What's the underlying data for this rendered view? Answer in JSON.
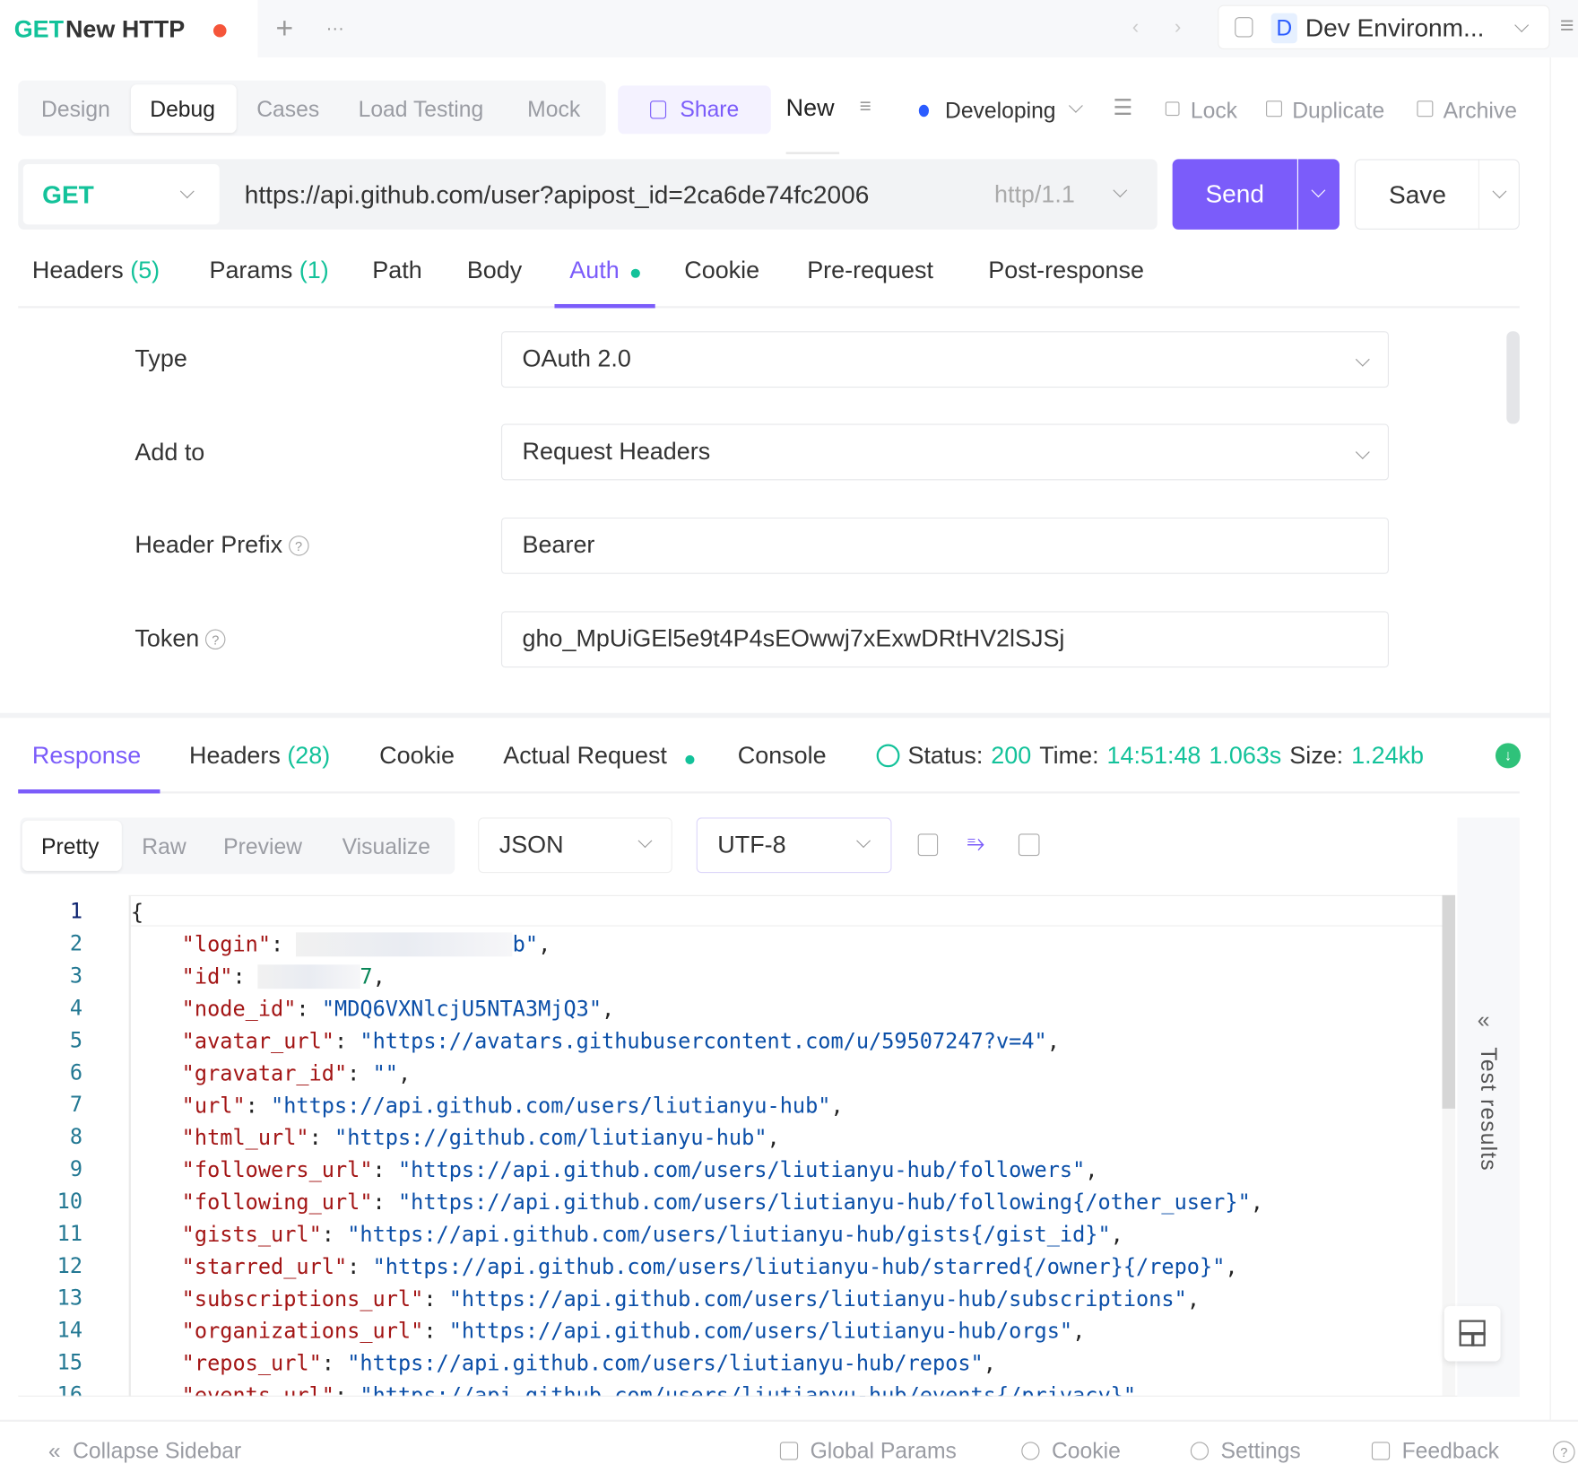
{
  "colors": {
    "accent": "#7b5cfa",
    "green": "#13c29a",
    "unsaved_dot": "#f5553a",
    "developing_dot": "#2b5cff"
  },
  "tabbar": {
    "method": "GET",
    "title": "New HTTP",
    "add": "+",
    "more": "···",
    "env_badge": "D",
    "env": "Dev Environm..."
  },
  "modes": [
    {
      "label": "Design"
    },
    {
      "label": "Debug",
      "active": true
    },
    {
      "label": "Cases"
    },
    {
      "label": "Load Testing"
    },
    {
      "label": "Mock"
    }
  ],
  "toolbar": {
    "share": "Share",
    "new": "New",
    "status": "Developing",
    "lock": "Lock",
    "duplicate": "Duplicate",
    "archive": "Archive"
  },
  "request": {
    "method": "GET",
    "url": "https://api.github.com/user?apipost_id=2ca6de74fc2006",
    "protocol": "http/1.1",
    "send": "Send",
    "save": "Save"
  },
  "req_tabs": {
    "headers": "Headers",
    "headers_count": "(5)",
    "params": "Params",
    "params_count": "(1)",
    "path": "Path",
    "body": "Body",
    "auth": "Auth",
    "cookie": "Cookie",
    "pre": "Pre-request",
    "post": "Post-response"
  },
  "auth": {
    "type_label": "Type",
    "type_value": "OAuth 2.0",
    "addto_label": "Add to",
    "addto_value": "Request Headers",
    "prefix_label": "Header Prefix",
    "prefix_value": "Bearer",
    "token_label": "Token",
    "token_value": "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"
  },
  "resp_tabs": {
    "response": "Response",
    "headers": "Headers",
    "headers_count": "(28)",
    "cookie": "Cookie",
    "actual": "Actual Request",
    "console": "Console"
  },
  "resp_status": {
    "status_label": "Status:",
    "status": "200",
    "time_label": "Time:",
    "time": "14:51:48",
    "duration": "1.063s",
    "size_label": "Size:",
    "size": "1.24kb"
  },
  "view_modes": [
    {
      "label": "Pretty",
      "active": true
    },
    {
      "label": "Raw"
    },
    {
      "label": "Preview"
    },
    {
      "label": "Visualize"
    }
  ],
  "format": "JSON",
  "encoding": "UTF-8",
  "test_results": "Test results",
  "code_lines": [
    [
      [
        "p",
        "{"
      ]
    ],
    [
      [
        "k",
        "    \"login\""
      ],
      [
        "p",
        ": "
      ],
      [
        "redact",
        "                 "
      ],
      [
        "s",
        "b\""
      ],
      [
        "p",
        ","
      ]
    ],
    [
      [
        "k",
        "    \"id\""
      ],
      [
        "p",
        ": "
      ],
      [
        "redact",
        "        "
      ],
      [
        "n",
        "7"
      ],
      [
        "p",
        ","
      ]
    ],
    [
      [
        "k",
        "    \"node_id\""
      ],
      [
        "p",
        ": "
      ],
      [
        "s",
        "\"MDQ6VXNlcjU5NTA3MjQ3\""
      ],
      [
        "p",
        ","
      ]
    ],
    [
      [
        "k",
        "    \"avatar_url\""
      ],
      [
        "p",
        ": "
      ],
      [
        "s",
        "\"https://avatars.githubusercontent.com/u/59507247?v=4\""
      ],
      [
        "p",
        ","
      ]
    ],
    [
      [
        "k",
        "    \"gravatar_id\""
      ],
      [
        "p",
        ": "
      ],
      [
        "s",
        "\"\""
      ],
      [
        "p",
        ","
      ]
    ],
    [
      [
        "k",
        "    \"url\""
      ],
      [
        "p",
        ": "
      ],
      [
        "s",
        "\"https://api.github.com/users/liutianyu-hub\""
      ],
      [
        "p",
        ","
      ]
    ],
    [
      [
        "k",
        "    \"html_url\""
      ],
      [
        "p",
        ": "
      ],
      [
        "s",
        "\"https://github.com/liutianyu-hub\""
      ],
      [
        "p",
        ","
      ]
    ],
    [
      [
        "k",
        "    \"followers_url\""
      ],
      [
        "p",
        ": "
      ],
      [
        "s",
        "\"https://api.github.com/users/liutianyu-hub/followers\""
      ],
      [
        "p",
        ","
      ]
    ],
    [
      [
        "k",
        "    \"following_url\""
      ],
      [
        "p",
        ": "
      ],
      [
        "s",
        "\"https://api.github.com/users/liutianyu-hub/following{/other_user}\""
      ],
      [
        "p",
        ","
      ]
    ],
    [
      [
        "k",
        "    \"gists_url\""
      ],
      [
        "p",
        ": "
      ],
      [
        "s",
        "\"https://api.github.com/users/liutianyu-hub/gists{/gist_id}\""
      ],
      [
        "p",
        ","
      ]
    ],
    [
      [
        "k",
        "    \"starred_url\""
      ],
      [
        "p",
        ": "
      ],
      [
        "s",
        "\"https://api.github.com/users/liutianyu-hub/starred{/owner}{/repo}\""
      ],
      [
        "p",
        ","
      ]
    ],
    [
      [
        "k",
        "    \"subscriptions_url\""
      ],
      [
        "p",
        ": "
      ],
      [
        "s",
        "\"https://api.github.com/users/liutianyu-hub/subscriptions\""
      ],
      [
        "p",
        ","
      ]
    ],
    [
      [
        "k",
        "    \"organizations_url\""
      ],
      [
        "p",
        ": "
      ],
      [
        "s",
        "\"https://api.github.com/users/liutianyu-hub/orgs\""
      ],
      [
        "p",
        ","
      ]
    ],
    [
      [
        "k",
        "    \"repos_url\""
      ],
      [
        "p",
        ": "
      ],
      [
        "s",
        "\"https://api.github.com/users/liutianyu-hub/repos\""
      ],
      [
        "p",
        ","
      ]
    ],
    [
      [
        "k",
        "    \"events_url\""
      ],
      [
        "p",
        ": "
      ],
      [
        "s",
        "\"https://api.github.com/users/liutianyu-hub/events{/privacy}\""
      ]
    ]
  ],
  "footer": {
    "collapse": "Collapse Sidebar",
    "global_params": "Global Params",
    "cookie": "Cookie",
    "settings": "Settings",
    "feedback": "Feedback",
    "help": "?"
  }
}
